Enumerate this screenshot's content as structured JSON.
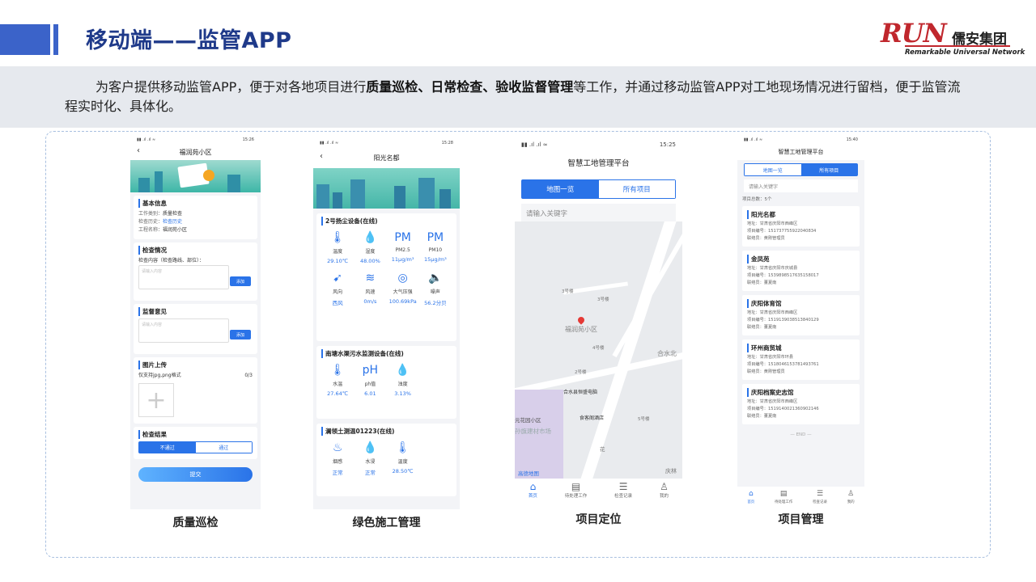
{
  "page": {
    "title": "移动端——监管APP",
    "intro_pre": "为客户提供移动监管APP，便于对各地项目进行",
    "intro_bold": "质量巡检、日常检查、验收监督管理",
    "intro_post": "等工作，并通过移动监管APP对工地现场情况进行留档，便于监管流程实时化、具体化。"
  },
  "logo": {
    "mark": "RUN",
    "cn": "儒安集团",
    "sub": "Remarkable Universal Network",
    "color": "#c0272d"
  },
  "captions": [
    "质量巡检",
    "绿色施工管理",
    "项目定位",
    "项目管理"
  ],
  "phone1": {
    "time": "15:26",
    "title": "福润苑小区",
    "basic": {
      "title": "基本信息",
      "rows": [
        {
          "k": "工作类别：",
          "v": "质量检查"
        },
        {
          "k": "检查历史：",
          "v": "检查历史"
        },
        {
          "k": "工程名称：",
          "v": "福润苑小区"
        }
      ]
    },
    "inspect": {
      "title": "检查情况",
      "label": "检查内容（检查路线、部位）：",
      "placeholder": "请输入内容",
      "btn": "添加"
    },
    "opinion": {
      "title": "监督意见",
      "placeholder": "请输入内容",
      "btn": "添加"
    },
    "upload": {
      "title": "图片上传",
      "hint": "仅支持jpg,png格式",
      "count": "0/3"
    },
    "result": {
      "title": "检查结果",
      "fail": "不通过",
      "pass": "通过"
    },
    "submit": "提交"
  },
  "phone2": {
    "time": "15:28",
    "title": "阳光名都",
    "dust": {
      "title": "2号扬尘设备(在线)",
      "items": [
        {
          "icon": "🌡",
          "name": "thermometer-icon",
          "label": "温度",
          "value": "29.10℃"
        },
        {
          "icon": "💧",
          "name": "humidity-icon",
          "label": "湿度",
          "value": "48.00%"
        },
        {
          "icon": "PM",
          "name": "pm25-icon",
          "label": "PM2.5",
          "value": "11μg/m³"
        },
        {
          "icon": "PM",
          "name": "pm10-icon",
          "label": "PM10",
          "value": "15μg/m³"
        },
        {
          "icon": "➹",
          "name": "wind-direction-icon",
          "label": "风向",
          "value": "西风"
        },
        {
          "icon": "≋",
          "name": "wind-speed-icon",
          "label": "风速",
          "value": "0m/s"
        },
        {
          "icon": "◎",
          "name": "pressure-icon",
          "label": "大气压强",
          "value": "100.69kPa"
        },
        {
          "icon": "🔈",
          "name": "noise-icon",
          "label": "噪声",
          "value": "56.2分贝"
        }
      ]
    },
    "water": {
      "title": "南塘水渠污水监测设备(在线)",
      "items": [
        {
          "icon": "🌡",
          "name": "water-temp-icon",
          "label": "水温",
          "value": "27.64℃"
        },
        {
          "icon": "pH",
          "name": "ph-icon",
          "label": "ph值",
          "value": "6.01"
        },
        {
          "icon": "💧",
          "name": "turbidity-icon",
          "label": "浊度",
          "value": "3.13%"
        }
      ]
    },
    "soil": {
      "title": "澜领土测温01223(在线)",
      "items": [
        {
          "icon": "♨",
          "name": "smoke-icon",
          "label": "烟感",
          "value": "正常"
        },
        {
          "icon": "💧",
          "name": "immersion-icon",
          "label": "水浸",
          "value": "正常"
        },
        {
          "icon": "🌡",
          "name": "temperature-icon",
          "label": "温度",
          "value": "28.50℃"
        }
      ]
    }
  },
  "phone3": {
    "time": "15:25",
    "title": "智慧工地管理平台",
    "tab_map": "地图一览",
    "tab_all": "所有项目",
    "search_placeholder": "请输入关键字",
    "map_labels": [
      "3号楼",
      "3号楼",
      "福润苑小区",
      "4号楼",
      "2号楼",
      "合水北"
    ],
    "poi1": "合水县恒盛电脑",
    "poi2": "食客阁酒店",
    "poi3": "5号楼",
    "poi4": "元花园小区",
    "poi5": "孙旗建材市场",
    "poi6": "庆林",
    "poi7": "花",
    "map_brand": "高德地图",
    "nav": [
      "首页",
      "待处理工作",
      "检查记录",
      "我的"
    ]
  },
  "phone4": {
    "time": "15:40",
    "title": "智慧工地管理平台",
    "tab_map": "地图一览",
    "tab_all": "所有项目",
    "search_placeholder": "请输入关键字",
    "total": "项目总数：5个",
    "projects": [
      {
        "name": "阳光名都",
        "addr": "地址：甘肃省庆阳市西峰区",
        "code": "项目编号：15173775592204083​4",
        "contact": "联络员：黄刚管理员"
      },
      {
        "name": "金凤苑",
        "addr": "地址：甘肃省庆阳市庆城县",
        "code": "项目编号：1539898517635158017",
        "contact": "联络员：董夏南"
      },
      {
        "name": "庆阳体育馆",
        "addr": "地址：甘肃省庆阳市西峰区",
        "code": "项目编号：1519139038513840129",
        "contact": "联络员：董夏南"
      },
      {
        "name": "环州商贸城",
        "addr": "地址：甘肃省庆阳市环县",
        "code": "项目编号：1518046153781493761",
        "contact": "联络员：黄刚管理员"
      },
      {
        "name": "庆阳档案史志馆",
        "addr": "地址：甘肃省庆阳市西峰区",
        "code": "项目编号：1519140021360902146",
        "contact": "联络员：董夏南"
      }
    ],
    "end": "— END —",
    "nav": [
      "首页",
      "待处理工作",
      "检查记录",
      "我的"
    ]
  }
}
